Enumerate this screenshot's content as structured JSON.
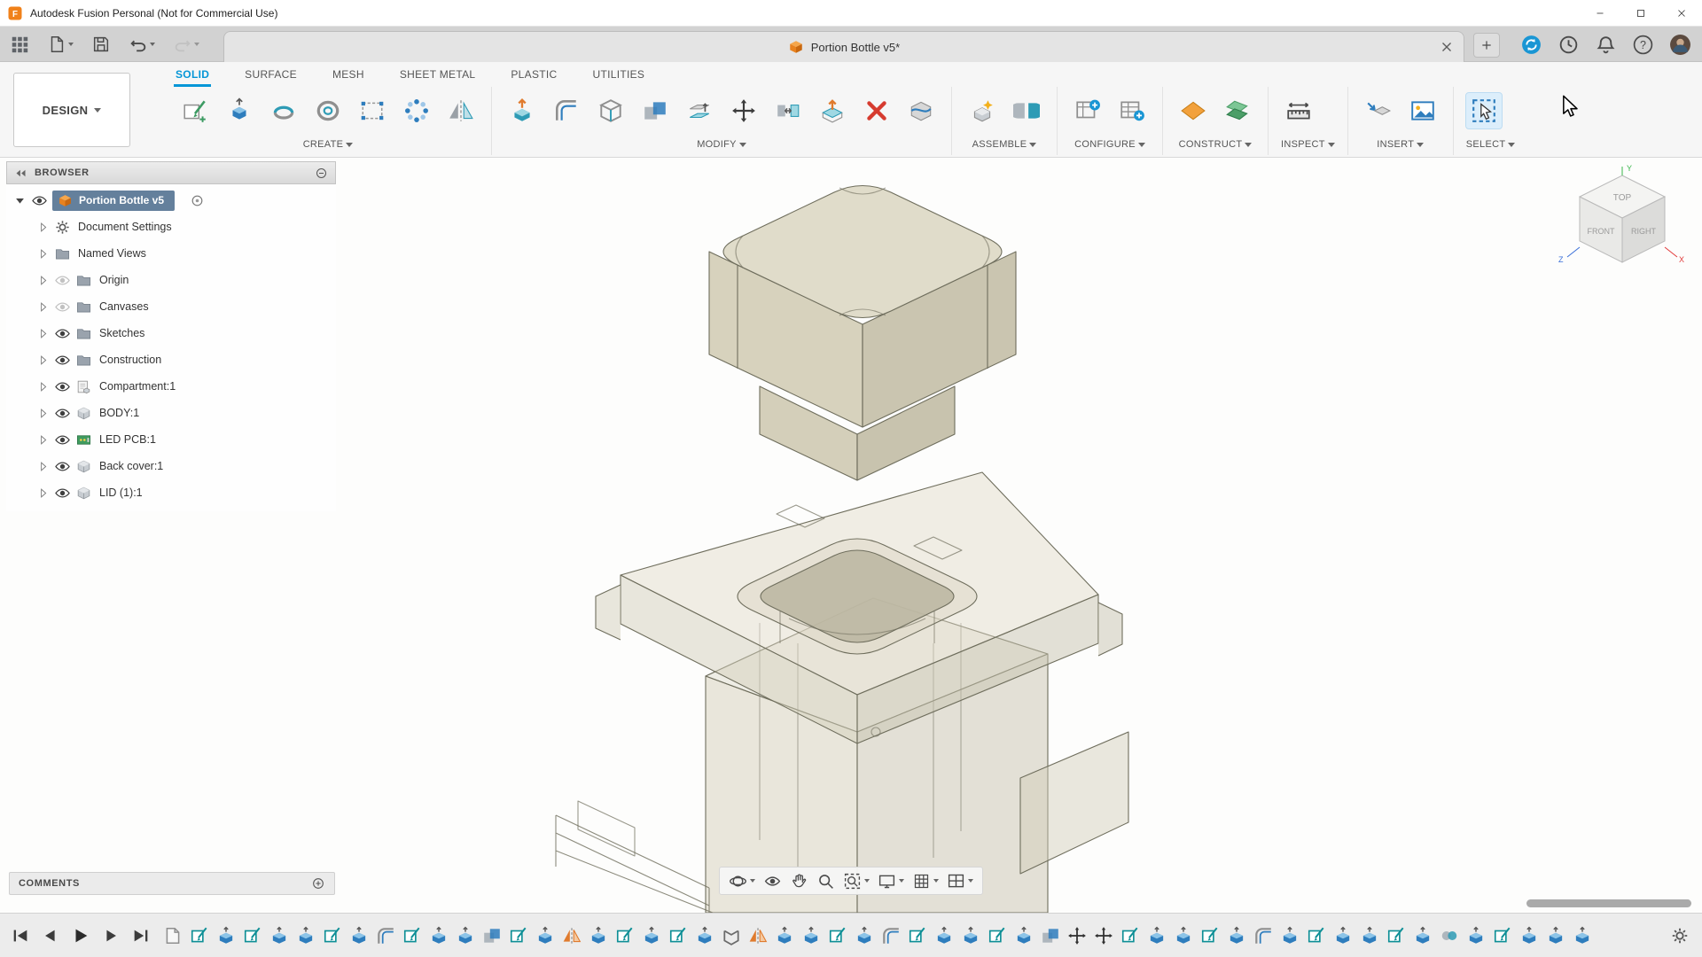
{
  "title_bar": {
    "app_title": "Autodesk Fusion Personal (Not for Commercial Use)"
  },
  "quick_access": {
    "icons": [
      "apps-grid",
      "file-menu",
      "save",
      "undo",
      "redo"
    ]
  },
  "document_tab": {
    "label": "Portion Bottle v5*"
  },
  "utility_icons": [
    "extensions",
    "job-status",
    "notifications",
    "help",
    "avatar"
  ],
  "ribbon": {
    "workspace_label": "DESIGN",
    "tabs": [
      {
        "label": "SOLID",
        "active": true
      },
      {
        "label": "SURFACE",
        "active": false
      },
      {
        "label": "MESH",
        "active": false
      },
      {
        "label": "SHEET METAL",
        "active": false
      },
      {
        "label": "PLASTIC",
        "active": false
      },
      {
        "label": "UTILITIES",
        "active": false
      }
    ],
    "groups": [
      {
        "label": "CREATE",
        "icons": [
          "create-sketch",
          "extrude",
          "revolve",
          "coil",
          "pattern-rect",
          "pattern-circular",
          "mirror"
        ]
      },
      {
        "label": "MODIFY",
        "icons": [
          "press-pull",
          "fillet",
          "shell",
          "combine",
          "offset-face",
          "move",
          "align",
          "replace-face",
          "delete",
          "split-body"
        ]
      },
      {
        "label": "ASSEMBLE",
        "icons": [
          "new-component",
          "joint"
        ]
      },
      {
        "label": "CONFIGURE",
        "icons": [
          "configuration",
          "configuration-table"
        ]
      },
      {
        "label": "CONSTRUCT",
        "icons": [
          "construct-plane",
          "construct-planes"
        ]
      },
      {
        "label": "INSPECT",
        "icons": [
          "measure"
        ]
      },
      {
        "label": "INSERT",
        "icons": [
          "insert-derive",
          "insert-image"
        ]
      },
      {
        "label": "SELECT",
        "icons": [
          "select-cursor"
        ]
      }
    ]
  },
  "browser": {
    "header": "BROWSER",
    "root_label": "Portion Bottle v5",
    "items": [
      {
        "label": "Document Settings",
        "icon": "gear",
        "eye": null
      },
      {
        "label": "Named Views",
        "icon": "folder",
        "eye": null
      },
      {
        "label": "Origin",
        "icon": "folder",
        "eye": "off"
      },
      {
        "label": "Canvases",
        "icon": "folder",
        "eye": "off"
      },
      {
        "label": "Sketches",
        "icon": "folder",
        "eye": "on"
      },
      {
        "label": "Construction",
        "icon": "folder",
        "eye": "on"
      },
      {
        "label": "Compartment:1",
        "icon": "component",
        "eye": "on"
      },
      {
        "label": "BODY:1",
        "icon": "body",
        "eye": "on"
      },
      {
        "label": "LED PCB:1",
        "icon": "pcb",
        "eye": "on"
      },
      {
        "label": "Back cover:1",
        "icon": "body",
        "eye": "on"
      },
      {
        "label": "LID (1):1",
        "icon": "body",
        "eye": "on"
      }
    ]
  },
  "view_cube": {
    "top": "TOP",
    "front": "FRONT",
    "right": "RIGHT",
    "axis_x": "X",
    "axis_y": "Y",
    "axis_z": "Z"
  },
  "comments_bar": {
    "label": "COMMENTS"
  },
  "nav_bar": {
    "items": [
      {
        "name": "orbit",
        "caret": true
      },
      {
        "name": "look-at",
        "caret": false
      },
      {
        "name": "pan",
        "caret": false
      },
      {
        "name": "zoom",
        "caret": false
      },
      {
        "name": "fit",
        "caret": true
      },
      {
        "name": "display-settings",
        "caret": true
      },
      {
        "name": "grid-display",
        "caret": true
      },
      {
        "name": "viewports",
        "caret": true
      }
    ]
  },
  "timeline": {
    "playback": [
      "skip-start",
      "step-back",
      "play",
      "step-forward",
      "skip-end"
    ],
    "features": [
      "component",
      "sketch",
      "extrude",
      "sketch",
      "extrude",
      "extrude",
      "sketch",
      "extrude",
      "fillet",
      "sketch",
      "extrude",
      "extrude",
      "combine",
      "sketch",
      "extrude",
      "mirror",
      "extrude",
      "sketch",
      "extrude",
      "sketch",
      "extrude",
      "shell",
      "mirror",
      "extrude",
      "extrude",
      "sketch",
      "extrude",
      "fillet",
      "sketch",
      "extrude",
      "extrude",
      "sketch",
      "extrude",
      "combine",
      "move",
      "move",
      "sketch",
      "extrude",
      "extrude",
      "sketch",
      "extrude",
      "fillet",
      "extrude",
      "sketch",
      "extrude",
      "extrude",
      "sketch",
      "extrude",
      "joint",
      "extrude",
      "sketch",
      "extrude",
      "extrude",
      "extrude"
    ]
  },
  "colors": {
    "accent_blue": "#0696d7",
    "selection_blue_gray": "#64809c",
    "model_beige": "#d9d5c2",
    "construct_orange": "#f2a13c"
  }
}
